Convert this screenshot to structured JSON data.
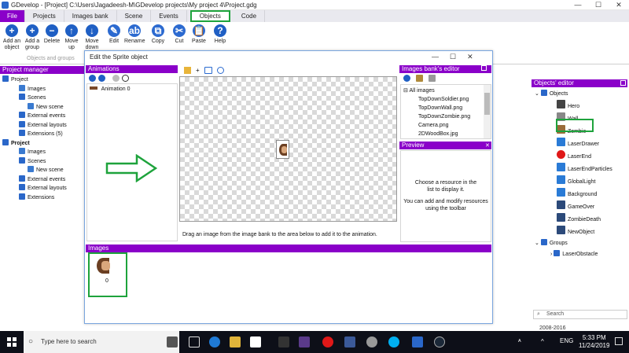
{
  "window": {
    "title": "GDevelop - [Project] C:\\Users\\Jagadeesh-M\\GDevelop projects\\My project 4\\Project.gdg",
    "min": "—",
    "max": "☐",
    "close": "✕"
  },
  "menu": {
    "tabs": [
      "File",
      "Projects",
      "Images bank",
      "Scene",
      "Events",
      "Objects",
      "Code"
    ],
    "active": "Objects"
  },
  "ribbon": {
    "buttons": [
      {
        "label": "Add an object",
        "icon": "add-object-icon",
        "glyph": "+",
        "color": "#1f5fc4"
      },
      {
        "label": "Add a group",
        "icon": "add-group-icon",
        "glyph": "+",
        "color": "#1f5fc4"
      },
      {
        "label": "Delete",
        "icon": "delete-icon",
        "glyph": "−",
        "color": "#1f5fc4"
      },
      {
        "label": "Move up",
        "icon": "move-up-icon",
        "glyph": "↑",
        "color": "#1f5fc4"
      },
      {
        "label": "Move down",
        "icon": "move-down-icon",
        "glyph": "↓",
        "color": "#1f5fc4"
      },
      {
        "label": "Edit",
        "icon": "edit-icon",
        "glyph": "✎",
        "color": "#2c6ad0"
      },
      {
        "label": "Rename",
        "icon": "rename-icon",
        "glyph": "ab",
        "color": "#2c6ad0"
      },
      {
        "label": "Copy",
        "icon": "copy-icon",
        "glyph": "⧉",
        "color": "#2c6ad0"
      },
      {
        "label": "Cut",
        "icon": "cut-icon",
        "glyph": "✂",
        "color": "#2c6ad0"
      },
      {
        "label": "Paste",
        "icon": "paste-icon",
        "glyph": "📋",
        "color": "#2c6ad0"
      },
      {
        "label": "Help",
        "icon": "help-icon",
        "glyph": "?",
        "color": "#1f5fc4"
      }
    ],
    "group_label": "Objects and groups"
  },
  "project_manager": {
    "title": "Project manager",
    "items": [
      {
        "label": "Project",
        "level": 0,
        "icon": "project-icon"
      },
      {
        "label": "Images",
        "level": 1,
        "icon": "images-icon"
      },
      {
        "label": "Scenes",
        "level": 1,
        "icon": "scenes-icon"
      },
      {
        "label": "New scene",
        "level": 2,
        "icon": "scene-icon"
      },
      {
        "label": "External events",
        "level": 1,
        "icon": "events-icon"
      },
      {
        "label": "External layouts",
        "level": 1,
        "icon": "layouts-icon"
      },
      {
        "label": "Extensions (5)",
        "level": 1,
        "icon": "extensions-icon"
      },
      {
        "label": "Project",
        "level": 0,
        "icon": "project-icon",
        "bold": true
      },
      {
        "label": "Images",
        "level": 1,
        "icon": "images-icon"
      },
      {
        "label": "Scenes",
        "level": 1,
        "icon": "scenes-icon"
      },
      {
        "label": "New scene",
        "level": 2,
        "icon": "scene-icon"
      },
      {
        "label": "External events",
        "level": 1,
        "icon": "events-icon"
      },
      {
        "label": "External layouts",
        "level": 1,
        "icon": "layouts-icon"
      },
      {
        "label": "Extensions",
        "level": 1,
        "icon": "extensions-icon"
      }
    ]
  },
  "sprite_dialog": {
    "title": "Edit the Sprite object",
    "animations_title": "Animations",
    "animation_item": "Animation 0",
    "canvas_hint": "Drag an image from the image bank to the area below to add it to the animation.",
    "images_title": "Images",
    "image_index": "0",
    "images_bank_title": "Images bank's editor",
    "all_images": "All images",
    "bank_files": [
      "TopDownSoldier.png",
      "TopDownWall.png",
      "TopDownZombie.png",
      "Camera.png",
      "2DWoodBox.jpg"
    ],
    "preview_title": "Preview",
    "preview_text_1": "Choose a resource in the list to display it.",
    "preview_text_2": "You can add and modify resources using the toolbar"
  },
  "objects_editor": {
    "title": "Objects' editor",
    "objects_label": "Objects",
    "objects": [
      {
        "label": "Hero",
        "icon": "hero-icon",
        "color": "#444444"
      },
      {
        "label": "Wall",
        "icon": "wall-icon",
        "color": "#888888"
      },
      {
        "label": "Zombie",
        "icon": "zombie-icon",
        "color": "#9a6b3a",
        "highlight": true
      },
      {
        "label": "LaserDrawer",
        "icon": "laser-drawer-icon",
        "color": "#2a7bd6"
      },
      {
        "label": "LaserEnd",
        "icon": "laser-end-icon",
        "color": "#e01818"
      },
      {
        "label": "LaserEndParticles",
        "icon": "particles-icon",
        "color": "#2a7bd6"
      },
      {
        "label": "GlobalLight",
        "icon": "light-icon",
        "color": "#2a7bd6"
      },
      {
        "label": "Background",
        "icon": "background-icon",
        "color": "#2a7bd6"
      },
      {
        "label": "GameOver",
        "icon": "text-icon",
        "color": "#2c4a7a"
      },
      {
        "label": "ZombieDeath",
        "icon": "text-icon",
        "color": "#2c4a7a"
      },
      {
        "label": "NewObject",
        "icon": "text-icon",
        "color": "#2c4a7a"
      }
    ],
    "groups_label": "Groups",
    "groups": [
      "LaserObstacle"
    ],
    "search_placeholder": "Search",
    "copyright": "2008-2016"
  },
  "taskbar": {
    "search_placeholder": "Type here to search",
    "time": "5:33 PM",
    "date": "11/24/2019",
    "lang": "ENG"
  },
  "colors": {
    "accent": "#8a00c9",
    "highlight": "#1ea33c"
  }
}
